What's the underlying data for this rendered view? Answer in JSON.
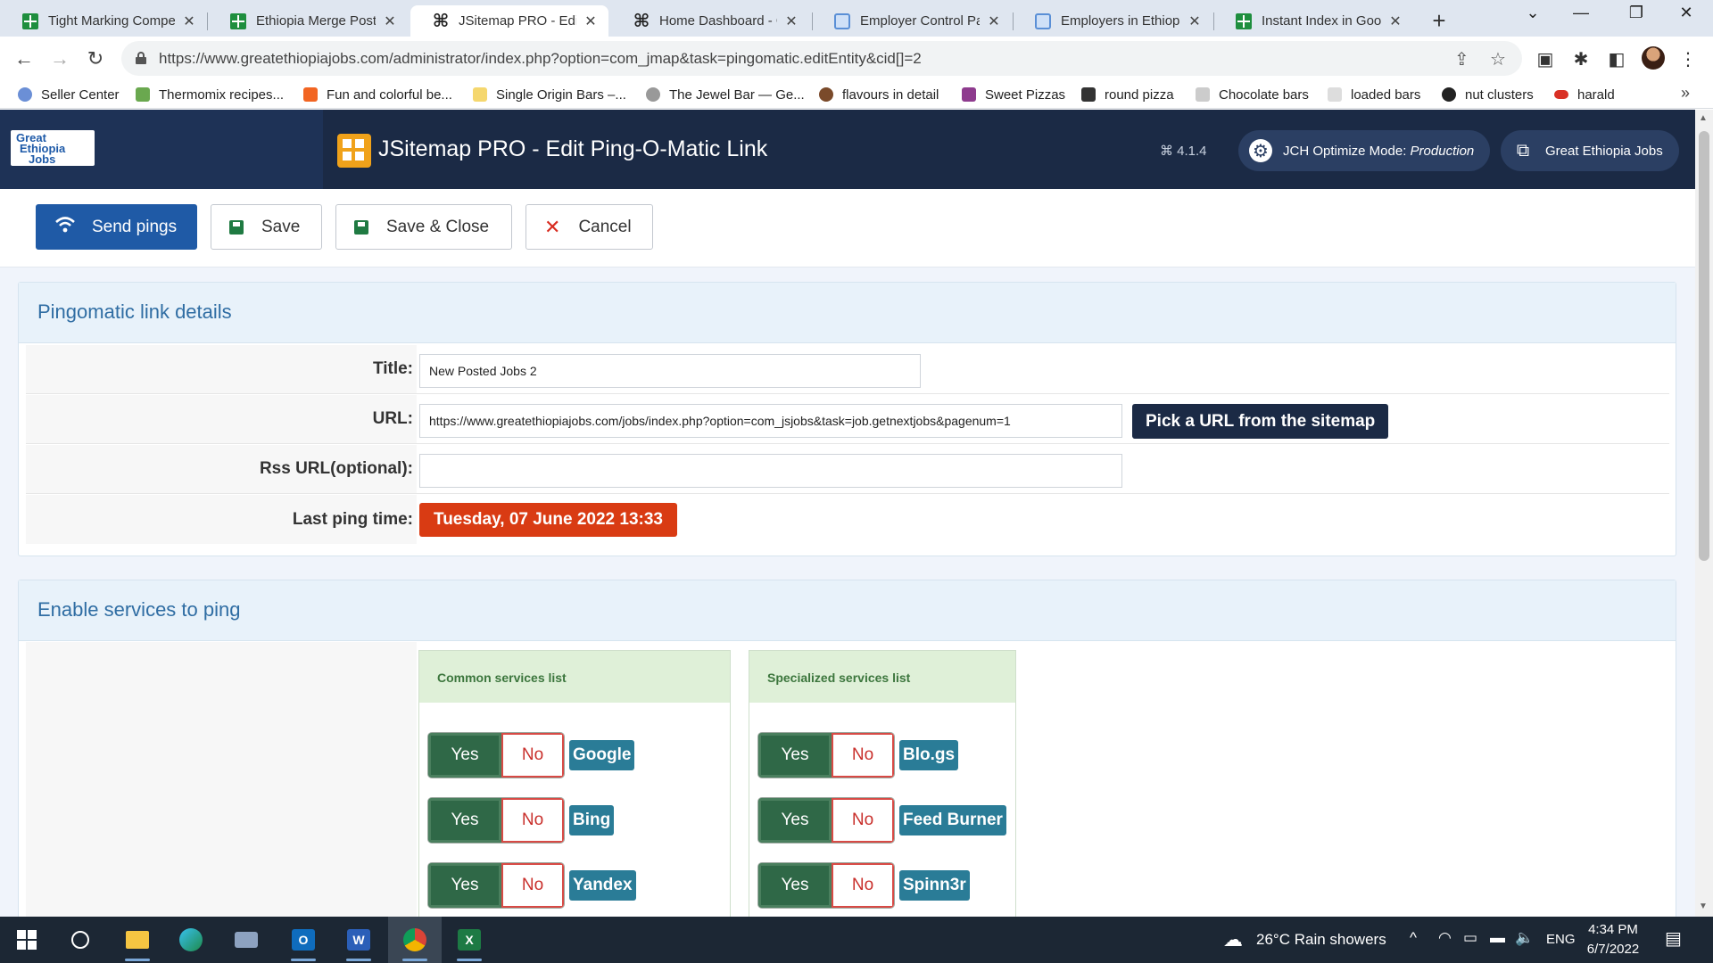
{
  "browser": {
    "tabs": [
      {
        "title": "Tight Marking Compe",
        "icon": "sheets-icon"
      },
      {
        "title": "Ethiopia Merge Postir",
        "icon": "sheets-icon"
      },
      {
        "title": "JSitemap PRO - Edit P",
        "icon": "joomla-icon",
        "active": true
      },
      {
        "title": "Home Dashboard - Gr",
        "icon": "joomla-icon"
      },
      {
        "title": "Employer Control Pan",
        "icon": "page-icon"
      },
      {
        "title": "Employers in Ethiopia",
        "icon": "page-icon"
      },
      {
        "title": "Instant Index in Goog",
        "icon": "sheets-icon"
      }
    ],
    "close_glyph": "✕",
    "new_tab_glyph": "+",
    "url": "https://www.greatethiopiajobs.com/administrator/index.php?option=com_jmap&task=pingomatic.editEntity&cid[]=2",
    "bookmarks": [
      {
        "label": "Seller Center",
        "color": "#6b8fd6"
      },
      {
        "label": "Thermomix recipes...",
        "color": "#6aa84f"
      },
      {
        "label": "Fun and colorful be...",
        "color": "#f26522"
      },
      {
        "label": "Single Origin Bars –...",
        "color": "#f5d76e"
      },
      {
        "label": "The Jewel Bar — Ge...",
        "color": "#999999"
      },
      {
        "label": "flavours in detail",
        "color": "#7a4a2a"
      },
      {
        "label": "Sweet Pizzas",
        "color": "#8e3b8e"
      },
      {
        "label": "round pizza",
        "color": "#333333"
      },
      {
        "label": "Chocolate bars",
        "color": "#cccccc"
      },
      {
        "label": "loaded bars",
        "color": "#dddddd"
      },
      {
        "label": "nut clusters",
        "color": "#222222"
      },
      {
        "label": "harald",
        "color": "#d93025"
      }
    ],
    "more_glyph": "»"
  },
  "header": {
    "logo_lines": [
      "Great",
      "Ethiopia",
      "Jobs"
    ],
    "title": "JSitemap PRO - Edit Ping-O-Matic Link",
    "version": "⌘ 4.1.4",
    "jch_label": "JCH Optimize Mode:",
    "jch_mode": "Production",
    "site_link": "Great Ethiopia Jobs"
  },
  "toolbar": {
    "send_pings": "Send pings",
    "save": "Save",
    "save_close": "Save & Close",
    "cancel": "Cancel"
  },
  "details": {
    "heading": "Pingomatic link details",
    "title_label": "Title:",
    "title_value": "New Posted Jobs 2",
    "url_label": "URL:",
    "url_value": "https://www.greatethiopiajobs.com/jobs/index.php?option=com_jsjobs&task=job.getnextjobs&pagenum=1",
    "pick_url": "Pick a URL from the sitemap",
    "rss_label": "Rss URL(optional):",
    "rss_value": "",
    "last_ping_label": "Last ping time:",
    "last_ping_value": "Tuesday, 07 June 2022 13:33"
  },
  "services": {
    "heading": "Enable services to ping",
    "yes": "Yes",
    "no": "No",
    "common": {
      "title": "Common services list",
      "items": [
        "Google",
        "Bing",
        "Yandex"
      ]
    },
    "specialized": {
      "title": "Specialized services list",
      "items": [
        "Blo.gs",
        "Feed Burner",
        "Spinn3r"
      ]
    }
  },
  "taskbar": {
    "weather": "26°C  Rain showers",
    "lang": "ENG",
    "time": "4:34 PM",
    "date": "6/7/2022"
  }
}
